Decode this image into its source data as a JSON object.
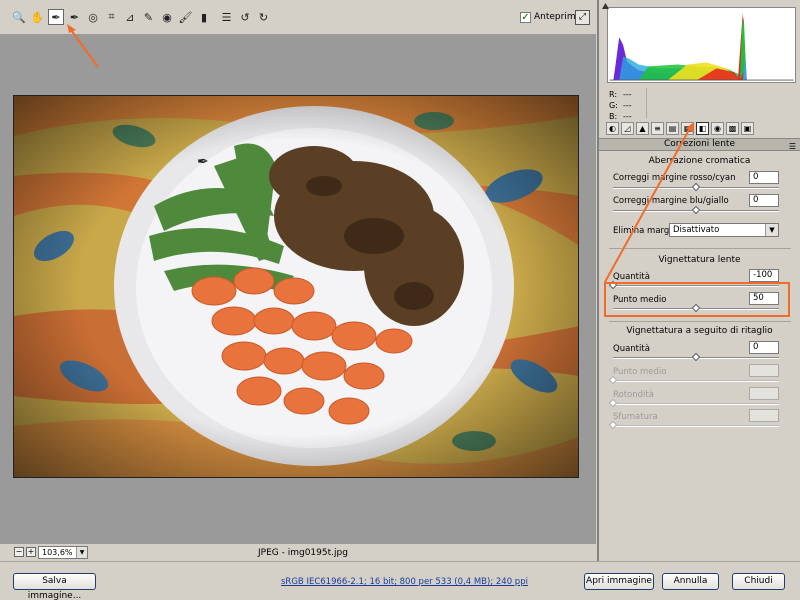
{
  "toolbar": {
    "tools": [
      {
        "name": "zoom-tool",
        "glyph": "🔍"
      },
      {
        "name": "hand-tool",
        "glyph": "✋"
      },
      {
        "name": "white-balance-tool",
        "glyph": "✒"
      },
      {
        "name": "color-sampler-tool",
        "glyph": "✒"
      },
      {
        "name": "target-adjustment-tool",
        "glyph": "◎"
      },
      {
        "name": "crop-tool",
        "glyph": "⌗"
      },
      {
        "name": "straighten-tool",
        "glyph": "⊿"
      },
      {
        "name": "spot-removal-tool",
        "glyph": "✎"
      },
      {
        "name": "red-eye-tool",
        "glyph": "◉"
      },
      {
        "name": "adjustment-brush-tool",
        "glyph": "🖌"
      },
      {
        "name": "graduated-filter-tool",
        "glyph": "▮"
      },
      {
        "name": "preferences-tool",
        "glyph": "☰"
      },
      {
        "name": "rotate-left-tool",
        "glyph": "↺"
      },
      {
        "name": "rotate-right-tool",
        "glyph": "↻"
      }
    ],
    "preview_label": "Anteprima",
    "preview_checked": "✓"
  },
  "status": {
    "zoom": "103,6%",
    "filename": "JPEG  -  img0195t.jpg",
    "zoom_out": "−",
    "zoom_in": "+"
  },
  "histogram": {
    "r": "---",
    "g": "---",
    "b": "---"
  },
  "panel": {
    "section_title": "Correzioni lente",
    "chromatic": {
      "title": "Aberrazione cromatica",
      "red_cyan_label": "Correggi margine rosso/cyan",
      "red_cyan_value": "0",
      "red_cyan_level": 0.5,
      "blue_yellow_label": "Correggi margine blu/giallo",
      "blue_yellow_value": "0",
      "blue_yellow_level": 0.5,
      "fringe_label": "Elimina margine:",
      "fringe_value": "Disattivato"
    },
    "vignette": {
      "title": "Vignettatura lente",
      "amount_label": "Quantità",
      "amount_value": "-100",
      "amount_level": 0.0,
      "midpoint_label": "Punto medio",
      "midpoint_value": "50",
      "midpoint_level": 0.5
    },
    "postcrop": {
      "title": "Vignettatura a seguito di ritaglio",
      "amount_label": "Quantità",
      "amount_value": "0",
      "amount_level": 0.5,
      "midpoint_label": "Punto medio",
      "roundness_label": "Rotondità",
      "feather_label": "Sfumatura"
    }
  },
  "bottom": {
    "save_label": "Salva immagine...",
    "info_link": "sRGB IEC61966-2.1; 16 bit; 800 per 533 (0,4 MB); 240 ppi",
    "open_label": "Apri immagine",
    "cancel_label": "Annulla",
    "done_label": "Chiudi"
  },
  "colors": {
    "accent_orange": "#f36b2a",
    "canvas_gray": "#9a9a9a",
    "panel_gray": "#d4d0c8"
  }
}
